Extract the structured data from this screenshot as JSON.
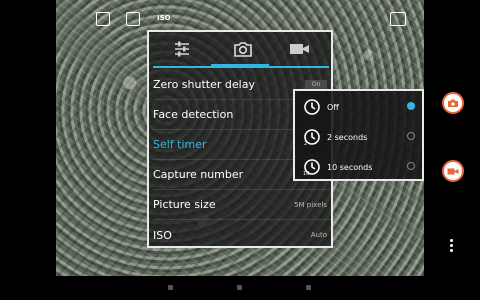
{
  "settings": {
    "tabs": [
      {
        "icon": "sliders-icon"
      },
      {
        "icon": "camera-icon",
        "active": true
      },
      {
        "icon": "video-icon"
      }
    ],
    "rows": [
      {
        "label": "Zero shutter delay",
        "value": "On"
      },
      {
        "label": "Face detection",
        "value": ""
      },
      {
        "label": "Self timer",
        "value": ""
      },
      {
        "label": "Capture number",
        "value": ""
      },
      {
        "label": "Picture size",
        "value": "5M pixels"
      },
      {
        "label": "ISO",
        "value": "Auto"
      }
    ]
  },
  "self_timer_popup": {
    "options": [
      {
        "label": "Off",
        "selected": true
      },
      {
        "label": "2 seconds",
        "selected": false
      },
      {
        "label": "10 seconds",
        "selected": false
      }
    ],
    "clock_badges": [
      "2",
      "10"
    ]
  },
  "status_bar": {
    "iso_label": "ISO"
  },
  "colors": {
    "accent": "#33b5e5",
    "capture_ring": "#e8673a"
  }
}
